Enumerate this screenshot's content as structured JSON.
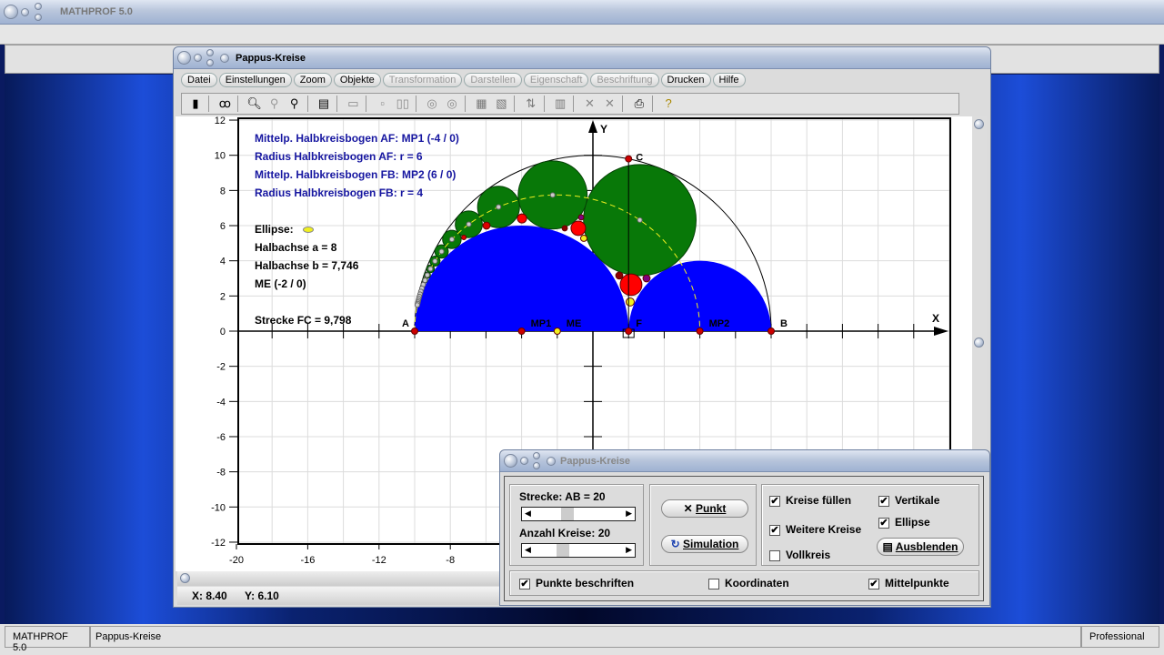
{
  "app": {
    "title": "MATHPROF 5.0"
  },
  "window": {
    "title": "Pappus-Kreise",
    "menu": [
      {
        "label": "Datei",
        "enabled": true
      },
      {
        "label": "Einstellungen",
        "enabled": true
      },
      {
        "label": "Zoom",
        "enabled": true
      },
      {
        "label": "Objekte",
        "enabled": true
      },
      {
        "label": "Transformation",
        "enabled": false
      },
      {
        "label": "Darstellen",
        "enabled": false
      },
      {
        "label": "Eigenschaft",
        "enabled": false
      },
      {
        "label": "Beschriftung",
        "enabled": false
      },
      {
        "label": "Drucken",
        "enabled": true
      },
      {
        "label": "Hilfe",
        "enabled": true
      }
    ],
    "toolbar": [
      "window-icon",
      "glasses-icon",
      "zoom-out-icon",
      "zoom-reset-icon",
      "zoom-in-icon",
      "properties-icon",
      "layout-icon",
      "frame-icon",
      "double-frame-icon",
      "circle1-icon",
      "circle2-icon",
      "table-icon",
      "chart-icon",
      "export-icon",
      "copy-icon",
      "cross1-icon",
      "cross2-icon",
      "print-icon",
      "help-icon"
    ],
    "info_blue": [
      "Mittelp. Halbkreisbogen AF: MP1 (-4 / 0)",
      "Radius Halbkreisbogen AF: r = 6",
      "Mittelp. Halbkreisbogen FB: MP2 (6 / 0)",
      "Radius Halbkreisbogen FB: r = 4"
    ],
    "ellipse_label": "Ellipse:",
    "info_black": [
      "Halbachse a = 8",
      "Halbachse b = 7,746",
      "ME (-2 / 0)"
    ],
    "strecke": "Strecke FC = 9,798",
    "coords": {
      "x": "X: 8.40",
      "y": "Y: 6.10"
    }
  },
  "chart_data": {
    "type": "geometry",
    "xlabel": "X",
    "ylabel": "Y",
    "xlim": [
      -20,
      20
    ],
    "ylim": [
      -12,
      12
    ],
    "grid": true,
    "xticks": [
      -20,
      -16,
      -12,
      -8
    ],
    "yticks": [
      12,
      10,
      8,
      6,
      4,
      2,
      0,
      -2,
      -4,
      -6,
      -8,
      -10,
      -12
    ],
    "big_circle": {
      "cx": 0,
      "r": 10
    },
    "semicircle_AF": {
      "cx": -4,
      "r": 6
    },
    "semicircle_FB": {
      "cx": 6,
      "r": 4
    },
    "chain_count": 20,
    "ellipse": {
      "cx": -2,
      "a": 8,
      "b": 7.746
    },
    "points": [
      {
        "label": "A",
        "x": -10,
        "y": 0
      },
      {
        "label": "MP1",
        "x": -4,
        "y": 0
      },
      {
        "label": "ME",
        "x": -2,
        "y": 0
      },
      {
        "label": "F",
        "x": 2,
        "y": 0
      },
      {
        "label": "MP2",
        "x": 6,
        "y": 0
      },
      {
        "label": "B",
        "x": 10,
        "y": 0
      },
      {
        "label": "C",
        "x": 2,
        "y": 9.798
      }
    ],
    "extra_circles": [
      {
        "x": 2.14,
        "y": 2.64,
        "r": 0.61,
        "color": "#ff0000"
      },
      {
        "x": -0.82,
        "y": 5.85,
        "r": 0.41,
        "color": "#ff0000"
      },
      {
        "x": -3.98,
        "y": 6.41,
        "r": 0.26,
        "color": "#ff0000"
      },
      {
        "x": 2.09,
        "y": 1.66,
        "r": 0.23,
        "color": "#f0f020"
      },
      {
        "x": -0.51,
        "y": 5.28,
        "r": 0.18,
        "color": "#f0f020"
      },
      {
        "x": 1.48,
        "y": 3.16,
        "r": 0.2,
        "color": "#8b0000"
      },
      {
        "x": 3.01,
        "y": 3.0,
        "r": 0.2,
        "color": "#800080"
      },
      {
        "x": -0.66,
        "y": 6.47,
        "r": 0.15,
        "color": "#800080"
      },
      {
        "x": -1.58,
        "y": 5.85,
        "r": 0.15,
        "color": "#8b0000"
      },
      {
        "x": -5.97,
        "y": 6.0,
        "r": 0.2,
        "color": "#dd0000"
      },
      {
        "x": -7.24,
        "y": 5.33,
        "r": 0.13,
        "color": "#dd0000"
      }
    ],
    "colors": {
      "semicircles": "#0000ff",
      "chain": "#087808",
      "ellipse": "#f0f020",
      "points": "#cc0000"
    }
  },
  "dialog": {
    "title": "Pappus-Kreise",
    "strecke": "Strecke:  AB = 20",
    "strecke_slider": 0.3,
    "anzahl": "Anzahl Kreise:  20",
    "anzahl_slider": 0.25,
    "punkt": "Punkt",
    "simulation": "Simulation",
    "kreise_fuellen": {
      "label": "Kreise füllen",
      "checked": true
    },
    "weitere_kreise": {
      "label": "Weitere Kreise",
      "checked": true
    },
    "vollkreis": {
      "label": "Vollkreis",
      "checked": false
    },
    "vertikale": {
      "label": "Vertikale",
      "checked": true
    },
    "ellipse": {
      "label": "Ellipse",
      "checked": true
    },
    "ausblenden": "Ausblenden",
    "punkte_beschriften": {
      "label": "Punkte beschriften",
      "checked": true
    },
    "koordinaten": {
      "label": "Koordinaten",
      "checked": false
    },
    "mittelpunkte": {
      "label": "Mittelpunkte",
      "checked": true
    }
  },
  "statusbar": {
    "app": "MATHPROF 5.0",
    "doc": "Pappus-Kreise",
    "edition": "Professional"
  }
}
